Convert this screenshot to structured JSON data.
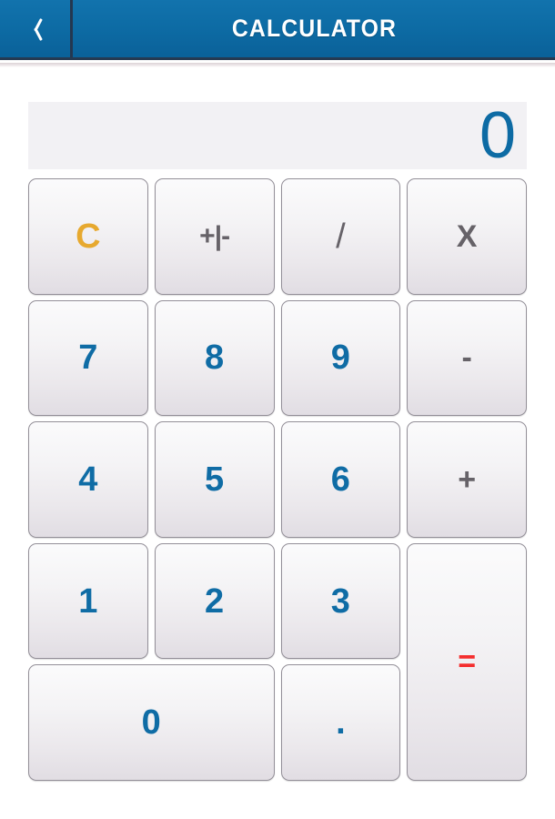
{
  "header": {
    "title": "CALCULATOR",
    "back_icon": "chevron-left-icon",
    "background_color": "#0d6ba4",
    "title_color": "#ffffff"
  },
  "display": {
    "value": "0",
    "text_color": "#0d6ba4",
    "background_color": "#f2f1f4"
  },
  "keypad": {
    "row1": [
      {
        "label": "C",
        "name": "clear-button",
        "kind": "clear",
        "color": "#e7a92f"
      },
      {
        "label": "+|-",
        "name": "sign-toggle-button",
        "kind": "signchange",
        "color": "#666268"
      },
      {
        "label": "/",
        "name": "divide-button",
        "kind": "op-slash",
        "color": "#666268"
      },
      {
        "label": "X",
        "name": "multiply-button",
        "kind": "op",
        "color": "#666268"
      }
    ],
    "row2": [
      {
        "label": "7",
        "name": "digit-7-button",
        "kind": "digit",
        "color": "#0f6ca5"
      },
      {
        "label": "8",
        "name": "digit-8-button",
        "kind": "digit",
        "color": "#0f6ca5"
      },
      {
        "label": "9",
        "name": "digit-9-button",
        "kind": "digit",
        "color": "#0f6ca5"
      },
      {
        "label": "-",
        "name": "subtract-button",
        "kind": "op",
        "color": "#666268"
      }
    ],
    "row3": [
      {
        "label": "4",
        "name": "digit-4-button",
        "kind": "digit",
        "color": "#0f6ca5"
      },
      {
        "label": "5",
        "name": "digit-5-button",
        "kind": "digit",
        "color": "#0f6ca5"
      },
      {
        "label": "6",
        "name": "digit-6-button",
        "kind": "digit",
        "color": "#0f6ca5"
      },
      {
        "label": "+",
        "name": "add-button",
        "kind": "op",
        "color": "#666268"
      }
    ],
    "row4": [
      {
        "label": "1",
        "name": "digit-1-button",
        "kind": "digit",
        "color": "#0f6ca5"
      },
      {
        "label": "2",
        "name": "digit-2-button",
        "kind": "digit",
        "color": "#0f6ca5"
      },
      {
        "label": "3",
        "name": "digit-3-button",
        "kind": "digit",
        "color": "#0f6ca5"
      }
    ],
    "equals": {
      "label": "=",
      "name": "equals-button",
      "kind": "equals",
      "color": "#f42e2e"
    },
    "zero": {
      "label": "0",
      "name": "digit-0-button",
      "kind": "digit",
      "color": "#0f6ca5"
    },
    "decimal": {
      "label": ".",
      "name": "decimal-point-button",
      "kind": "dot",
      "color": "#0f6ca5"
    }
  }
}
